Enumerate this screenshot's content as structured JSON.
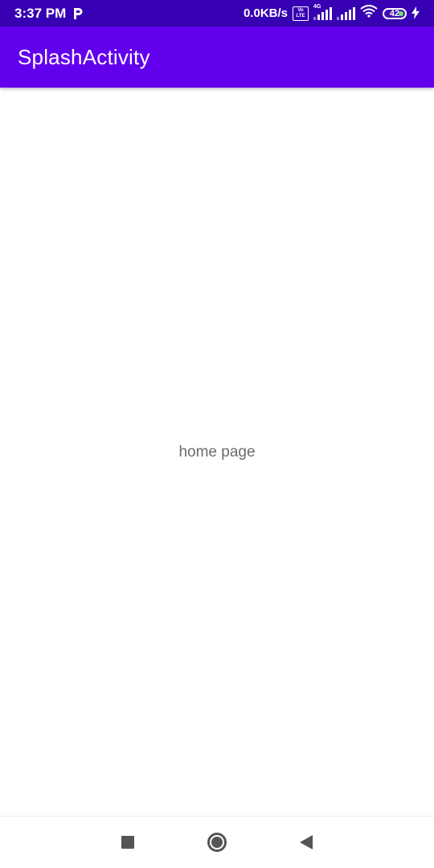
{
  "status_bar": {
    "time": "3:37 PM",
    "app_notification_icon": "parking-p-icon",
    "net_speed": "0.0KB/s",
    "volte_top": "Vo",
    "volte_bottom": "LTE",
    "network_type": "4G",
    "battery_level": "42",
    "icons": [
      "volte-icon",
      "signal-4g-icon",
      "signal-icon",
      "wifi-icon",
      "battery-icon",
      "charging-bolt-icon"
    ],
    "battery_fill_color": "#6ee36e"
  },
  "app_bar": {
    "title": "SplashActivity",
    "color": "#6200ee"
  },
  "content": {
    "text": "home page"
  },
  "nav_bar": {
    "buttons": [
      "recents-button",
      "home-button",
      "back-button"
    ]
  },
  "colors": {
    "status_bar_bg": "#3700b3",
    "app_bar_bg": "#6200ee",
    "body_bg": "#ffffff",
    "content_text": "#6b6b6b",
    "nav_icon": "#555555"
  }
}
